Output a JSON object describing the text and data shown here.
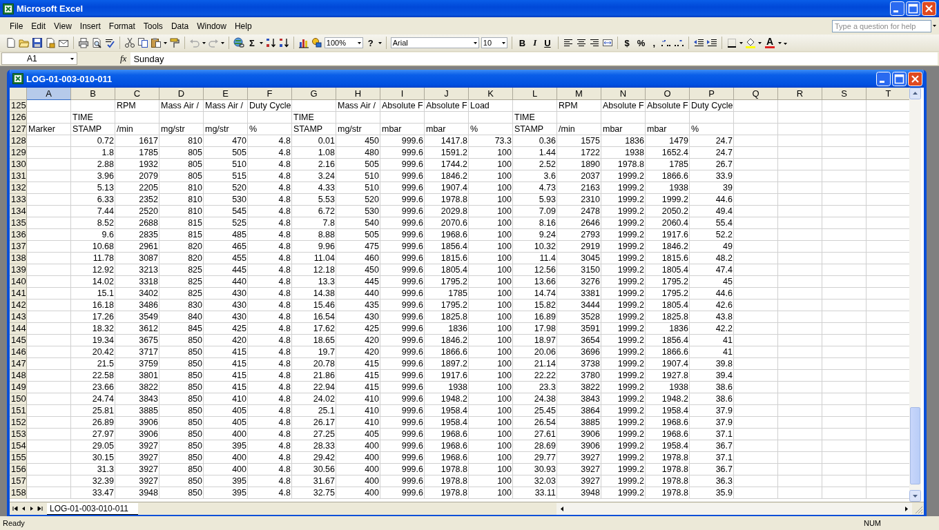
{
  "window": {
    "title": "Microsoft Excel"
  },
  "menu": [
    "File",
    "Edit",
    "View",
    "Insert",
    "Format",
    "Tools",
    "Data",
    "Window",
    "Help"
  ],
  "help_search": {
    "placeholder": "Type a question for help"
  },
  "toolbar": {
    "sum": "Σ",
    "zoom": "100%",
    "help": "?",
    "font": "Arial",
    "font_size": "10",
    "bold": "B",
    "italic": "I",
    "underline": "U",
    "currency": "$",
    "percent": "%",
    "comma": ",",
    "font_color": "A"
  },
  "formula_bar": {
    "name_box": "A1",
    "function_label": "fx",
    "value": "Sunday"
  },
  "workbook": {
    "title": "LOG-01-003-010-011",
    "columns": [
      {
        "label": "A",
        "selected": true
      },
      {
        "label": "B",
        "selected": false
      },
      {
        "label": "C",
        "selected": false
      },
      {
        "label": "D",
        "selected": false
      },
      {
        "label": "E",
        "selected": false
      },
      {
        "label": "F",
        "selected": false
      },
      {
        "label": "G",
        "selected": false
      },
      {
        "label": "H",
        "selected": false
      },
      {
        "label": "I",
        "selected": false
      },
      {
        "label": "J",
        "selected": false
      },
      {
        "label": "K",
        "selected": false
      },
      {
        "label": "L",
        "selected": false
      },
      {
        "label": "M",
        "selected": false
      },
      {
        "label": "N",
        "selected": false
      },
      {
        "label": "O",
        "selected": false
      },
      {
        "label": "P",
        "selected": false
      },
      {
        "label": "Q",
        "selected": false
      },
      {
        "label": "R",
        "selected": false
      },
      {
        "label": "S",
        "selected": false
      },
      {
        "label": "T",
        "selected": false
      }
    ],
    "rows": [
      {
        "number": "125",
        "cells": {
          "C": "RPM",
          "D": "Mass Air /",
          "E": "Mass Air /",
          "F": "Duty Cycle",
          "H": "Mass Air /",
          "I": "Absolute F",
          "J": "Absolute F",
          "K": "Load",
          "M": "RPM",
          "N": "Absolute F",
          "O": "Absolute F",
          "P": "Duty Cycle"
        }
      },
      {
        "number": "126",
        "cells": {
          "B": "TIME",
          "G": "TIME",
          "L": "TIME"
        }
      },
      {
        "number": "127",
        "cells": {
          "A": "Marker",
          "B": "STAMP",
          "C": "/min",
          "D": "mg/str",
          "E": "mg/str",
          "F": "%",
          "G": "STAMP",
          "H": "mg/str",
          "I": "mbar",
          "J": "mbar",
          "K": "%",
          "L": "STAMP",
          "M": "/min",
          "N": "mbar",
          "O": "mbar",
          "P": "%"
        }
      },
      {
        "number": "128",
        "values": [
          "0.72",
          "1617",
          "810",
          "470",
          "4.8",
          "0.01",
          "450",
          "999.6",
          "1417.8",
          "73.3",
          "0.36",
          "1575",
          "1836",
          "1479",
          "24.7"
        ]
      },
      {
        "number": "129",
        "values": [
          "1.8",
          "1785",
          "805",
          "505",
          "4.8",
          "1.08",
          "480",
          "999.6",
          "1591.2",
          "100",
          "1.44",
          "1722",
          "1938",
          "1652.4",
          "24.7"
        ]
      },
      {
        "number": "130",
        "values": [
          "2.88",
          "1932",
          "805",
          "510",
          "4.8",
          "2.16",
          "505",
          "999.6",
          "1744.2",
          "100",
          "2.52",
          "1890",
          "1978.8",
          "1785",
          "26.7"
        ]
      },
      {
        "number": "131",
        "values": [
          "3.96",
          "2079",
          "805",
          "515",
          "4.8",
          "3.24",
          "510",
          "999.6",
          "1846.2",
          "100",
          "3.6",
          "2037",
          "1999.2",
          "1866.6",
          "33.9"
        ]
      },
      {
        "number": "132",
        "values": [
          "5.13",
          "2205",
          "810",
          "520",
          "4.8",
          "4.33",
          "510",
          "999.6",
          "1907.4",
          "100",
          "4.73",
          "2163",
          "1999.2",
          "1938",
          "39"
        ]
      },
      {
        "number": "133",
        "values": [
          "6.33",
          "2352",
          "810",
          "530",
          "4.8",
          "5.53",
          "520",
          "999.6",
          "1978.8",
          "100",
          "5.93",
          "2310",
          "1999.2",
          "1999.2",
          "44.6"
        ]
      },
      {
        "number": "134",
        "values": [
          "7.44",
          "2520",
          "810",
          "545",
          "4.8",
          "6.72",
          "530",
          "999.6",
          "2029.8",
          "100",
          "7.09",
          "2478",
          "1999.2",
          "2050.2",
          "49.4"
        ]
      },
      {
        "number": "135",
        "values": [
          "8.52",
          "2688",
          "815",
          "525",
          "4.8",
          "7.8",
          "540",
          "999.6",
          "2070.6",
          "100",
          "8.16",
          "2646",
          "1999.2",
          "2060.4",
          "55.4"
        ]
      },
      {
        "number": "136",
        "values": [
          "9.6",
          "2835",
          "815",
          "485",
          "4.8",
          "8.88",
          "505",
          "999.6",
          "1968.6",
          "100",
          "9.24",
          "2793",
          "1999.2",
          "1917.6",
          "52.2"
        ]
      },
      {
        "number": "137",
        "values": [
          "10.68",
          "2961",
          "820",
          "465",
          "4.8",
          "9.96",
          "475",
          "999.6",
          "1856.4",
          "100",
          "10.32",
          "2919",
          "1999.2",
          "1846.2",
          "49"
        ]
      },
      {
        "number": "138",
        "values": [
          "11.78",
          "3087",
          "820",
          "455",
          "4.8",
          "11.04",
          "460",
          "999.6",
          "1815.6",
          "100",
          "11.4",
          "3045",
          "1999.2",
          "1815.6",
          "48.2"
        ]
      },
      {
        "number": "139",
        "values": [
          "12.92",
          "3213",
          "825",
          "445",
          "4.8",
          "12.18",
          "450",
          "999.6",
          "1805.4",
          "100",
          "12.56",
          "3150",
          "1999.2",
          "1805.4",
          "47.4"
        ]
      },
      {
        "number": "140",
        "values": [
          "14.02",
          "3318",
          "825",
          "440",
          "4.8",
          "13.3",
          "445",
          "999.6",
          "1795.2",
          "100",
          "13.66",
          "3276",
          "1999.2",
          "1795.2",
          "45"
        ]
      },
      {
        "number": "141",
        "values": [
          "15.1",
          "3402",
          "825",
          "430",
          "4.8",
          "14.38",
          "440",
          "999.6",
          "1785",
          "100",
          "14.74",
          "3381",
          "1999.2",
          "1795.2",
          "44.6"
        ]
      },
      {
        "number": "142",
        "values": [
          "16.18",
          "3486",
          "830",
          "430",
          "4.8",
          "15.46",
          "435",
          "999.6",
          "1795.2",
          "100",
          "15.82",
          "3444",
          "1999.2",
          "1805.4",
          "42.6"
        ]
      },
      {
        "number": "143",
        "values": [
          "17.26",
          "3549",
          "840",
          "430",
          "4.8",
          "16.54",
          "430",
          "999.6",
          "1825.8",
          "100",
          "16.89",
          "3528",
          "1999.2",
          "1825.8",
          "43.8"
        ]
      },
      {
        "number": "144",
        "values": [
          "18.32",
          "3612",
          "845",
          "425",
          "4.8",
          "17.62",
          "425",
          "999.6",
          "1836",
          "100",
          "17.98",
          "3591",
          "1999.2",
          "1836",
          "42.2"
        ]
      },
      {
        "number": "145",
        "values": [
          "19.34",
          "3675",
          "850",
          "420",
          "4.8",
          "18.65",
          "420",
          "999.6",
          "1846.2",
          "100",
          "18.97",
          "3654",
          "1999.2",
          "1856.4",
          "41"
        ]
      },
      {
        "number": "146",
        "values": [
          "20.42",
          "3717",
          "850",
          "415",
          "4.8",
          "19.7",
          "420",
          "999.6",
          "1866.6",
          "100",
          "20.06",
          "3696",
          "1999.2",
          "1866.6",
          "41"
        ]
      },
      {
        "number": "147",
        "values": [
          "21.5",
          "3759",
          "850",
          "415",
          "4.8",
          "20.78",
          "415",
          "999.6",
          "1897.2",
          "100",
          "21.14",
          "3738",
          "1999.2",
          "1907.4",
          "39.8"
        ]
      },
      {
        "number": "148",
        "values": [
          "22.58",
          "3801",
          "850",
          "415",
          "4.8",
          "21.86",
          "415",
          "999.6",
          "1917.6",
          "100",
          "22.22",
          "3780",
          "1999.2",
          "1927.8",
          "39.4"
        ]
      },
      {
        "number": "149",
        "values": [
          "23.66",
          "3822",
          "850",
          "415",
          "4.8",
          "22.94",
          "415",
          "999.6",
          "1938",
          "100",
          "23.3",
          "3822",
          "1999.2",
          "1938",
          "38.6"
        ]
      },
      {
        "number": "150",
        "values": [
          "24.74",
          "3843",
          "850",
          "410",
          "4.8",
          "24.02",
          "410",
          "999.6",
          "1948.2",
          "100",
          "24.38",
          "3843",
          "1999.2",
          "1948.2",
          "38.6"
        ]
      },
      {
        "number": "151",
        "values": [
          "25.81",
          "3885",
          "850",
          "405",
          "4.8",
          "25.1",
          "410",
          "999.6",
          "1958.4",
          "100",
          "25.45",
          "3864",
          "1999.2",
          "1958.4",
          "37.9"
        ]
      },
      {
        "number": "152",
        "values": [
          "26.89",
          "3906",
          "850",
          "405",
          "4.8",
          "26.17",
          "410",
          "999.6",
          "1958.4",
          "100",
          "26.54",
          "3885",
          "1999.2",
          "1968.6",
          "37.9"
        ]
      },
      {
        "number": "153",
        "values": [
          "27.97",
          "3906",
          "850",
          "400",
          "4.8",
          "27.25",
          "405",
          "999.6",
          "1968.6",
          "100",
          "27.61",
          "3906",
          "1999.2",
          "1968.6",
          "37.1"
        ]
      },
      {
        "number": "154",
        "values": [
          "29.05",
          "3927",
          "850",
          "395",
          "4.8",
          "28.33",
          "400",
          "999.6",
          "1968.6",
          "100",
          "28.69",
          "3906",
          "1999.2",
          "1958.4",
          "36.7"
        ]
      },
      {
        "number": "155",
        "values": [
          "30.15",
          "3927",
          "850",
          "400",
          "4.8",
          "29.42",
          "400",
          "999.6",
          "1968.6",
          "100",
          "29.77",
          "3927",
          "1999.2",
          "1978.8",
          "37.1"
        ]
      },
      {
        "number": "156",
        "values": [
          "31.3",
          "3927",
          "850",
          "400",
          "4.8",
          "30.56",
          "400",
          "999.6",
          "1978.8",
          "100",
          "30.93",
          "3927",
          "1999.2",
          "1978.8",
          "36.7"
        ]
      },
      {
        "number": "157",
        "values": [
          "32.39",
          "3927",
          "850",
          "395",
          "4.8",
          "31.67",
          "400",
          "999.6",
          "1978.8",
          "100",
          "32.03",
          "3927",
          "1999.2",
          "1978.8",
          "36.3"
        ]
      },
      {
        "number": "158",
        "values": [
          "33.47",
          "3948",
          "850",
          "395",
          "4.8",
          "32.75",
          "400",
          "999.6",
          "1978.8",
          "100",
          "33.11",
          "3948",
          "1999.2",
          "1978.8",
          "35.9"
        ]
      }
    ],
    "sheet_tabs": [
      {
        "label": "LOG-01-003-010-011",
        "selected": true
      }
    ]
  },
  "status_bar": {
    "mode": "Ready",
    "indicator": "NUM"
  }
}
